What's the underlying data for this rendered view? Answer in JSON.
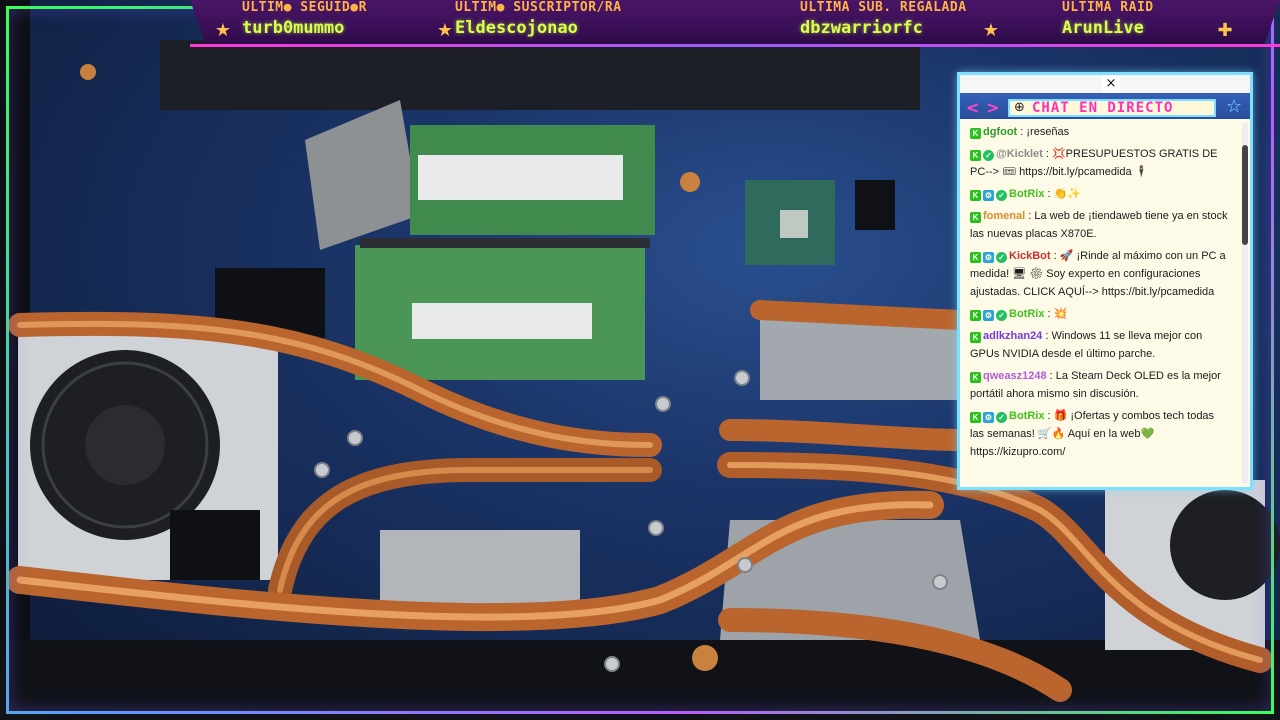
{
  "overlay": {
    "stats": [
      {
        "label": "ÚLTIM● SEGUID●R",
        "value": "turb0mummo"
      },
      {
        "label": "ÚLTIM● SUSCRIPTOR/RA",
        "value": "Eldescojonao"
      },
      {
        "label": "ÚLTIMA SUB. REGALADA",
        "value": "dbzwarriorfc"
      },
      {
        "label": "ÚLTIMA RAID",
        "value": "ArunLive"
      }
    ],
    "accent": "#ff3ad6",
    "label_color": "#ffb347",
    "value_color": "#d8ff4a"
  },
  "chat": {
    "close_glyph": "×",
    "prev_glyph": "<",
    "next_glyph": ">",
    "globe_glyph": "⊕",
    "title": "CHAT EN DIRECTO",
    "star_glyph": "☆",
    "messages": [
      {
        "user": "dgfoot",
        "color": "#2a9b2a",
        "badges": [
          "k"
        ],
        "text": "¡reseñas"
      },
      {
        "user": "@Kicklet",
        "color": "#8a8a8a",
        "badges": [
          "k",
          "v"
        ],
        "text": "💢PRESUPUESTOS GRATIS DE PC--> 🎟 https://bit.ly/pcamedida 🕴"
      },
      {
        "user": "BotRix",
        "color": "#44c11a",
        "badges": [
          "k",
          "p",
          "v"
        ],
        "text": "👏✨"
      },
      {
        "user": "fomenal",
        "color": "#e08a2a",
        "badges": [
          "k"
        ],
        "text": "La web de ¡tiendaweb tiene ya en stock las nuevas placas X870E."
      },
      {
        "user": "KickBot",
        "color": "#cf2d2d",
        "badges": [
          "k",
          "p",
          "v"
        ],
        "text": "🚀 ¡Rinde al máximo con un PC a medida! 🖥 ⚙ Soy experto en configuraciones ajustadas. CLICK AQUÍ--> https://bit.ly/pcamedida"
      },
      {
        "user": "BotRix",
        "color": "#44c11a",
        "badges": [
          "k",
          "p",
          "v"
        ],
        "text": "💥"
      },
      {
        "user": "adlkzhan24",
        "color": "#7a3ad9",
        "badges": [
          "k"
        ],
        "text": "Windows 11 se lleva mejor con GPUs NVIDIA desde el último parche."
      },
      {
        "user": "qweasz1248",
        "color": "#b45ad6",
        "badges": [
          "k"
        ],
        "text": "La Steam Deck OLED es la mejor portátil ahora mismo sin discusión."
      },
      {
        "user": "BotRix",
        "color": "#44c11a",
        "badges": [
          "k",
          "p",
          "v"
        ],
        "text": "🎁 ¡Ofertas y combos tech todas las semanas! 🛒🔥 Aquí en la web💚 https://kizupro.com/"
      }
    ]
  }
}
